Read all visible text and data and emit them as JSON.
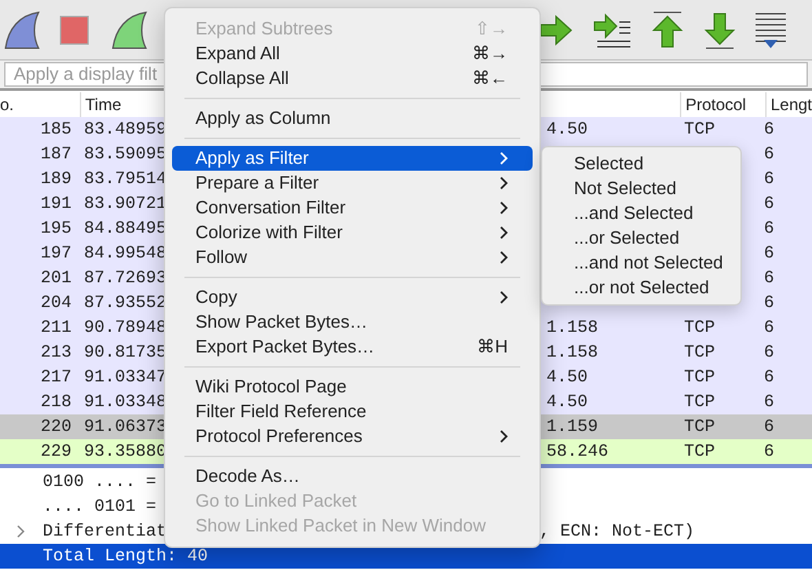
{
  "filter_bar": {
    "placeholder": "Apply a display filt"
  },
  "columns": [
    {
      "label": "o."
    },
    {
      "label": "Time"
    },
    {
      "label": "Protocol"
    },
    {
      "label": "Lengt"
    }
  ],
  "rows": [
    {
      "no": "185",
      "time": "83.48959",
      "destination": "4.50",
      "protocol": "TCP",
      "length": "6",
      "color": "#e7e6fe"
    },
    {
      "no": "187",
      "time": "83.59095",
      "length": "6",
      "color": "#e7e6fe"
    },
    {
      "no": "189",
      "time": "83.79514",
      "length": "6",
      "color": "#e7e6fe"
    },
    {
      "no": "191",
      "time": "83.90721",
      "length": "6",
      "color": "#e7e6fe"
    },
    {
      "no": "195",
      "time": "84.88495",
      "length": "6",
      "color": "#e7e6fe"
    },
    {
      "no": "197",
      "time": "84.99548",
      "length": "6",
      "color": "#e7e6fe"
    },
    {
      "no": "201",
      "time": "87.72693",
      "length": "6",
      "color": "#e7e6fe"
    },
    {
      "no": "204",
      "time": "87.93552",
      "length": "6",
      "color": "#e7e6fe"
    },
    {
      "no": "211",
      "time": "90.78948",
      "destination": "1.158",
      "protocol": "TCP",
      "length": "6",
      "color": "#e7e6fe"
    },
    {
      "no": "213",
      "time": "90.81735",
      "destination": "1.158",
      "protocol": "TCP",
      "length": "6",
      "color": "#e7e6fe"
    },
    {
      "no": "217",
      "time": "91.03347",
      "destination": "4.50",
      "protocol": "TCP",
      "length": "6",
      "color": "#e7e6fe"
    },
    {
      "no": "218",
      "time": "91.03348",
      "destination": "4.50",
      "protocol": "TCP",
      "length": "6",
      "color": "#e7e6fe"
    },
    {
      "no": "220",
      "time": "91.06373",
      "destination": "1.159",
      "protocol": "TCP",
      "length": "6",
      "color": "#c8c8c8"
    },
    {
      "no": "229",
      "time": "93.35880",
      "destination": "58.246",
      "protocol": "TCP",
      "length": "6",
      "color": "#e4ffc7"
    }
  ],
  "details": [
    {
      "left": "0100 .... =",
      "expandable": false,
      "selected": false
    },
    {
      "left": ".... 0101 =",
      "expandable": false,
      "selected": false
    },
    {
      "left": "Differentiat",
      "right": ", ECN: Not-ECT)",
      "expandable": true,
      "selected": false
    },
    {
      "left": "Total Length: 40",
      "expandable": false,
      "selected": true
    }
  ],
  "context_menu": {
    "items": [
      {
        "kind": "item",
        "label": "Expand Subtrees",
        "shortcut": "⇧→",
        "disabled": true,
        "submenu": false,
        "selected": false
      },
      {
        "kind": "item",
        "label": "Expand All",
        "shortcut": "⌘→",
        "disabled": false,
        "submenu": false,
        "selected": false
      },
      {
        "kind": "item",
        "label": "Collapse All",
        "shortcut": "⌘←",
        "disabled": false,
        "submenu": false,
        "selected": false
      },
      {
        "kind": "separator"
      },
      {
        "kind": "item",
        "label": "Apply as Column",
        "disabled": false,
        "submenu": false,
        "selected": false
      },
      {
        "kind": "separator"
      },
      {
        "kind": "item",
        "label": "Apply as Filter",
        "disabled": false,
        "submenu": true,
        "selected": true
      },
      {
        "kind": "item",
        "label": "Prepare a Filter",
        "disabled": false,
        "submenu": true,
        "selected": false
      },
      {
        "kind": "item",
        "label": "Conversation Filter",
        "disabled": false,
        "submenu": true,
        "selected": false
      },
      {
        "kind": "item",
        "label": "Colorize with Filter",
        "disabled": false,
        "submenu": true,
        "selected": false
      },
      {
        "kind": "item",
        "label": "Follow",
        "disabled": false,
        "submenu": true,
        "selected": false
      },
      {
        "kind": "separator"
      },
      {
        "kind": "item",
        "label": "Copy",
        "disabled": false,
        "submenu": true,
        "selected": false
      },
      {
        "kind": "item",
        "label": "Show Packet Bytes…",
        "disabled": false,
        "submenu": false,
        "selected": false
      },
      {
        "kind": "item",
        "label": "Export Packet Bytes…",
        "shortcut": "⌘H",
        "disabled": false,
        "submenu": false,
        "selected": false
      },
      {
        "kind": "separator"
      },
      {
        "kind": "item",
        "label": "Wiki Protocol Page",
        "disabled": false,
        "submenu": false,
        "selected": false
      },
      {
        "kind": "item",
        "label": "Filter Field Reference",
        "disabled": false,
        "submenu": false,
        "selected": false
      },
      {
        "kind": "item",
        "label": "Protocol Preferences",
        "disabled": false,
        "submenu": true,
        "selected": false
      },
      {
        "kind": "separator"
      },
      {
        "kind": "item",
        "label": "Decode As…",
        "disabled": false,
        "submenu": false,
        "selected": false
      },
      {
        "kind": "item",
        "label": "Go to Linked Packet",
        "disabled": true,
        "submenu": false,
        "selected": false
      },
      {
        "kind": "item",
        "label": "Show Linked Packet in New Window",
        "disabled": true,
        "submenu": false,
        "selected": false
      }
    ]
  },
  "submenu": {
    "items": [
      "Selected",
      "Not Selected",
      "...and Selected",
      "...or Selected",
      "...and not Selected",
      "...or not Selected"
    ]
  }
}
